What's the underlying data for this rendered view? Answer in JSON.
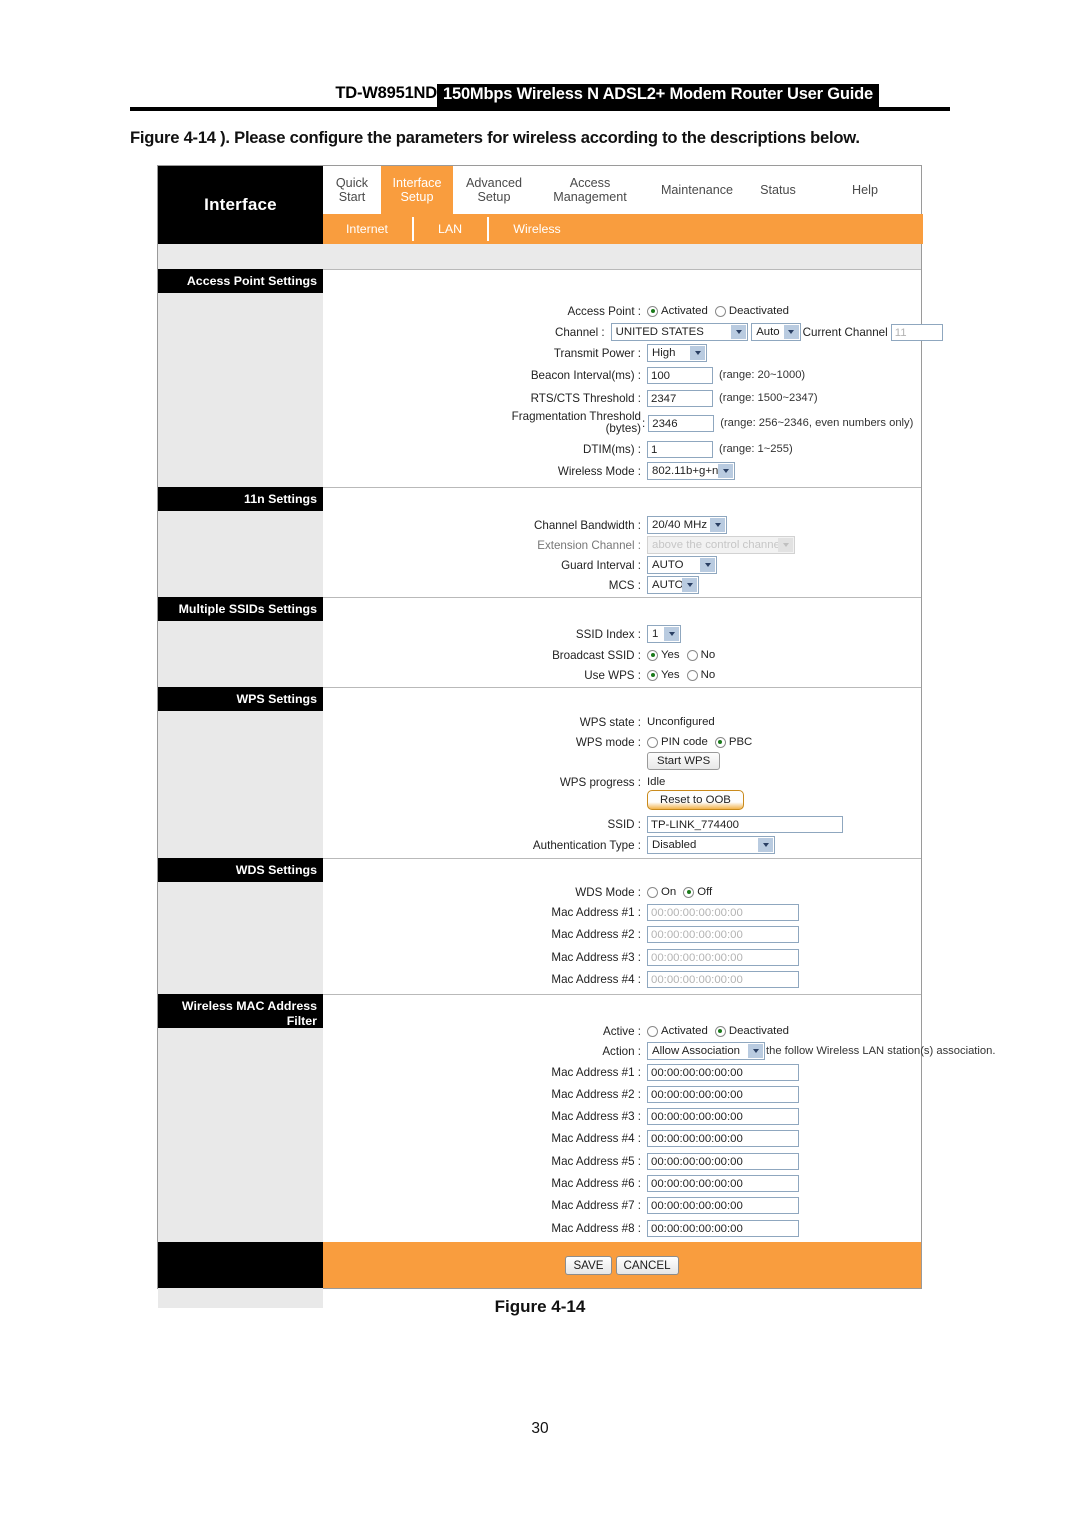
{
  "doc": {
    "model": "TD-W8951ND",
    "header_title": "150Mbps Wireless N ADSL2+ Modem Router User Guide",
    "caption": "Figure 4-14 ). Please configure the parameters for wireless according to the descriptions below.",
    "figure_label": "Figure 4-14",
    "page_number": "30"
  },
  "colors": {
    "accent_orange": "#F99D3E",
    "header_black": "#000000",
    "panel_grey": "#E9E9E9"
  },
  "ui": {
    "brand": "Interface",
    "menu": [
      {
        "label": "Quick\nStart",
        "line1": "Quick",
        "line2": "Start",
        "active": false
      },
      {
        "label": "Interface Setup",
        "line1": "Interface",
        "line2": "Setup",
        "active": true
      },
      {
        "label": "Advanced Setup",
        "line1": "Advanced",
        "line2": "Setup",
        "active": false
      },
      {
        "label": "Access Management",
        "line1": "Access",
        "line2": "Management",
        "active": false
      },
      {
        "label": "Maintenance",
        "line1": "Maintenance",
        "line2": "",
        "active": false
      },
      {
        "label": "Status",
        "line1": "Status",
        "line2": "",
        "active": false
      },
      {
        "label": "Help",
        "line1": "Help",
        "line2": "",
        "active": false
      }
    ],
    "subnav": [
      {
        "label": "Internet",
        "active": false
      },
      {
        "label": "LAN",
        "active": false
      },
      {
        "label": "Wireless",
        "active": true
      }
    ],
    "sections": {
      "access_point": {
        "title": "Access Point Settings",
        "access_point_label": "Access Point :",
        "access_point_options": [
          "Activated",
          "Deactivated"
        ],
        "access_point_value": "Activated",
        "channel_label": "Channel :",
        "channel_country": "UNITED STATES",
        "channel_mode": "Auto",
        "current_channel_label": "Current Channel",
        "current_channel_value": "11",
        "transmit_power_label": "Transmit Power :",
        "transmit_power_value": "High",
        "beacon_label": "Beacon Interval(ms) :",
        "beacon_value": "100",
        "beacon_hint": "(range: 20~1000)",
        "rts_label": "RTS/CTS Threshold :",
        "rts_value": "2347",
        "rts_hint": "(range: 1500~2347)",
        "frag_label_line1": "Fragmentation Threshold",
        "frag_label_line2": "(bytes)",
        "frag_value": "2346",
        "frag_hint": "(range: 256~2346, even numbers only)",
        "dtim_label": "DTIM(ms) :",
        "dtim_value": "1",
        "dtim_hint": "(range: 1~255)",
        "wireless_mode_label": "Wireless Mode :",
        "wireless_mode_value": "802.11b+g+n"
      },
      "n_settings": {
        "title": "11n Settings",
        "channel_bandwidth_label": "Channel Bandwidth :",
        "channel_bandwidth_value": "20/40 MHz",
        "extension_channel_label": "Extension Channel :",
        "extension_channel_value": "above the control channel",
        "guard_interval_label": "Guard Interval :",
        "guard_interval_value": "AUTO",
        "mcs_label": "MCS :",
        "mcs_value": "AUTO"
      },
      "multiple_ssids": {
        "title": "Multiple SSIDs Settings",
        "ssid_index_label": "SSID Index :",
        "ssid_index_value": "1",
        "broadcast_ssid_label": "Broadcast SSID :",
        "broadcast_ssid_value": "Yes",
        "broadcast_options": [
          "Yes",
          "No"
        ],
        "use_wps_label": "Use WPS :",
        "use_wps_value": "Yes",
        "use_wps_options": [
          "Yes",
          "No"
        ]
      },
      "wps": {
        "title": "WPS Settings",
        "state_label": "WPS state :",
        "state_value": "Unconfigured",
        "mode_label": "WPS mode :",
        "mode_options": [
          "PIN code",
          "PBC"
        ],
        "mode_value": "PBC",
        "start_button": "Start WPS",
        "progress_label": "WPS progress :",
        "progress_value": "Idle",
        "reset_button": "Reset to OOB",
        "ssid_label": "SSID :",
        "ssid_value": "TP-LINK_774400",
        "auth_label": "Authentication Type :",
        "auth_value": "Disabled"
      },
      "wds": {
        "title": "WDS Settings",
        "mode_label": "WDS Mode :",
        "mode_options": [
          "On",
          "Off"
        ],
        "mode_value": "Off",
        "mac_rows": [
          {
            "label": "Mac Address #1 :",
            "value": "00:00:00:00:00:00"
          },
          {
            "label": "Mac Address #2 :",
            "value": "00:00:00:00:00:00"
          },
          {
            "label": "Mac Address #3 :",
            "value": "00:00:00:00:00:00"
          },
          {
            "label": "Mac Address #4 :",
            "value": "00:00:00:00:00:00"
          }
        ]
      },
      "mac_filter": {
        "title_line1": "Wireless MAC Address",
        "title_line2": "Filter",
        "active_label": "Active :",
        "active_options": [
          "Activated",
          "Deactivated"
        ],
        "active_value": "Deactivated",
        "action_label": "Action :",
        "action_value": "Allow Association",
        "action_hint": "the follow Wireless LAN station(s) association.",
        "mac_rows": [
          {
            "label": "Mac Address #1 :",
            "value": "00:00:00:00:00:00"
          },
          {
            "label": "Mac Address #2 :",
            "value": "00:00:00:00:00:00"
          },
          {
            "label": "Mac Address #3 :",
            "value": "00:00:00:00:00:00"
          },
          {
            "label": "Mac Address #4 :",
            "value": "00:00:00:00:00:00"
          },
          {
            "label": "Mac Address #5 :",
            "value": "00:00:00:00:00:00"
          },
          {
            "label": "Mac Address #6 :",
            "value": "00:00:00:00:00:00"
          },
          {
            "label": "Mac Address #7 :",
            "value": "00:00:00:00:00:00"
          },
          {
            "label": "Mac Address #8 :",
            "value": "00:00:00:00:00:00"
          }
        ]
      }
    },
    "footer": {
      "save": "SAVE",
      "cancel": "CANCEL"
    }
  }
}
